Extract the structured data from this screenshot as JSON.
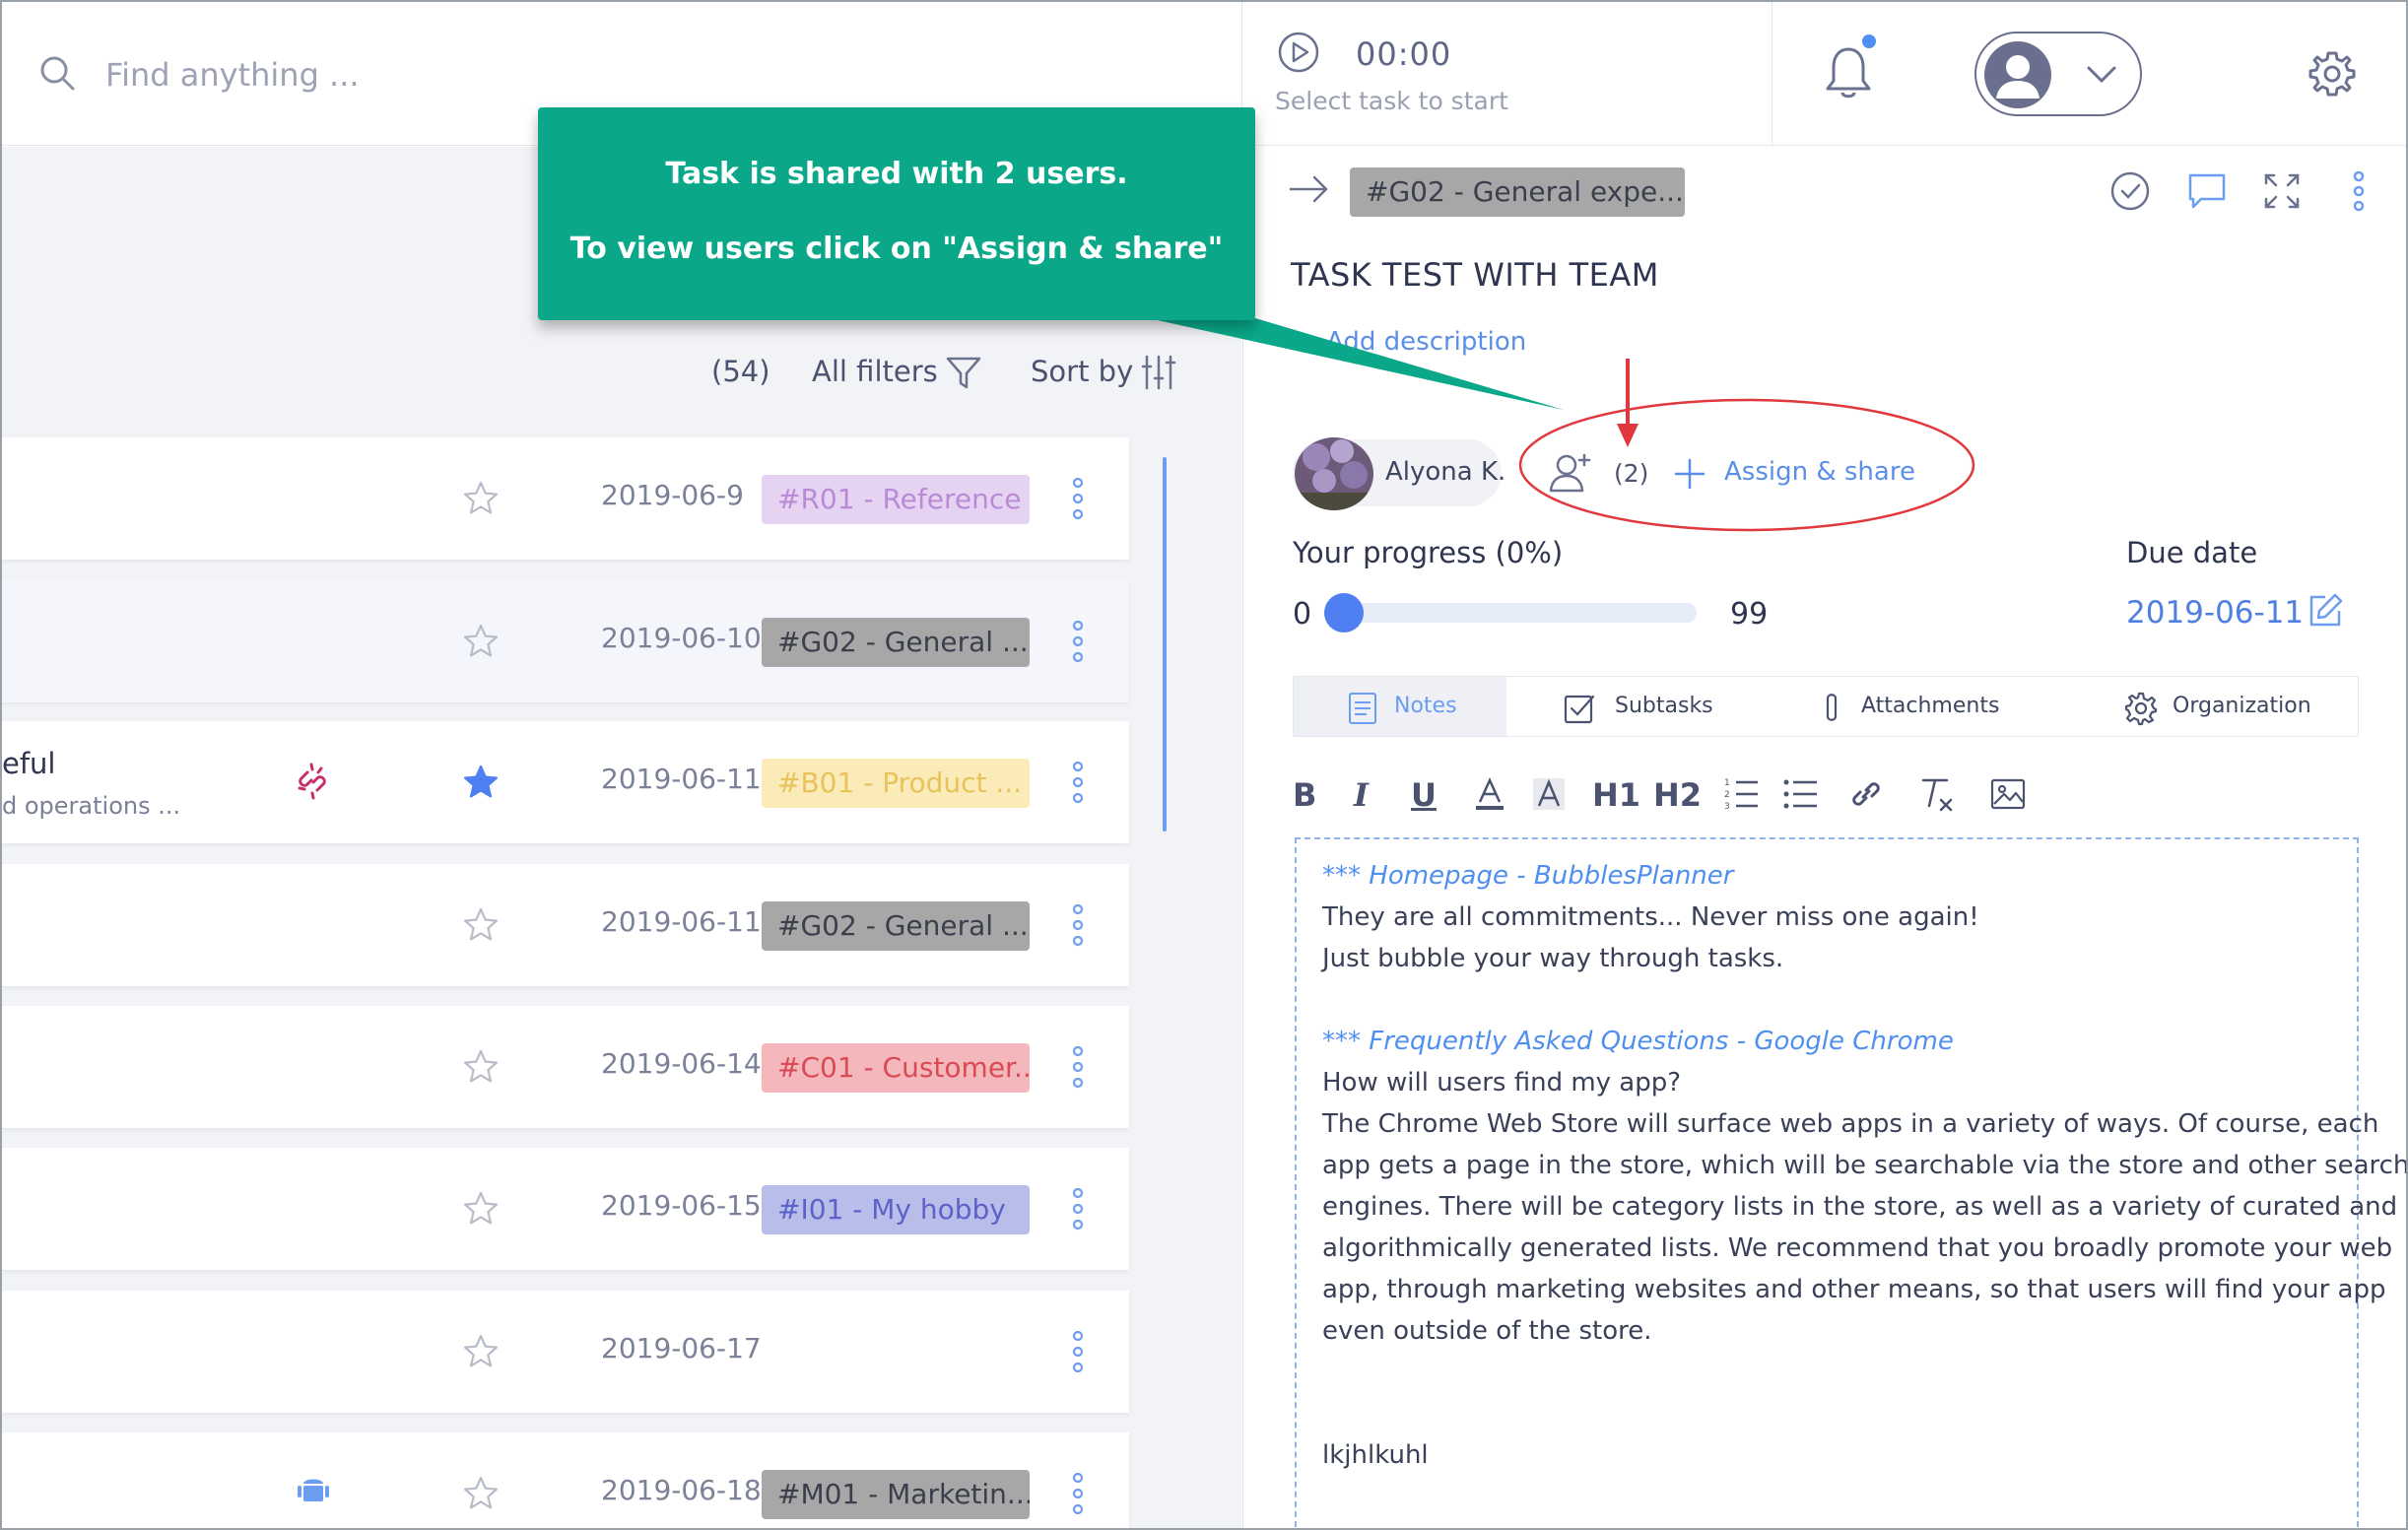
{
  "search": {
    "placeholder": "Find anything ..."
  },
  "timer": {
    "time": "00:00",
    "hint": "Select task to start"
  },
  "list_toolbar": {
    "count": "(54)",
    "filters_label": "All filters",
    "sort_label": "Sort by"
  },
  "rows": [
    {
      "title": "",
      "subtitle": "",
      "date": "2019-06-9",
      "tag": "#R01 - Reference",
      "tag_bg": "#e6d3f2",
      "tag_fg": "#b98ad6",
      "starred": false
    },
    {
      "title": "",
      "subtitle": "",
      "date": "2019-06-10",
      "tag": "#G02 - General ...",
      "tag_bg": "#a7a7a7",
      "tag_fg": "#3b3f4c",
      "starred": false
    },
    {
      "title": "eful",
      "subtitle": "d operations ...",
      "date": "2019-06-11",
      "tag": "#B01 - Product ...",
      "tag_bg": "#faebb8",
      "tag_fg": "#e8c25a",
      "starred": true
    },
    {
      "title": "",
      "subtitle": "",
      "date": "2019-06-11",
      "tag": "#G02 - General ...",
      "tag_bg": "#a7a7a7",
      "tag_fg": "#3b3f4c",
      "starred": false
    },
    {
      "title": "",
      "subtitle": "",
      "date": "2019-06-14",
      "tag": "#C01 - Customer...",
      "tag_bg": "#f3b7bc",
      "tag_fg": "#d94a55",
      "starred": false
    },
    {
      "title": "",
      "subtitle": "",
      "date": "2019-06-15",
      "tag": "#I01 - My hobby",
      "tag_bg": "#b9bde9",
      "tag_fg": "#5c63c8",
      "starred": false
    },
    {
      "title": "",
      "subtitle": "",
      "date": "2019-06-17",
      "tag": "",
      "tag_bg": "",
      "tag_fg": "",
      "starred": false
    },
    {
      "title": "",
      "subtitle": "",
      "date": "2019-06-18",
      "tag": "#M01 - Marketin...",
      "tag_bg": "#a7a7a7",
      "tag_fg": "#3b3f4c",
      "starred": false
    }
  ],
  "callout": {
    "line1": "Task is shared with 2 users.",
    "line2": "To view users click on \"Assign & share\""
  },
  "task": {
    "tag": "#G02 - General expe...",
    "title": "TASK TEST WITH TEAM",
    "add_description": "+ Add description",
    "assignee": "Alyona K.",
    "shared_count": "(2)",
    "assign_label": "Assign & share",
    "progress_label": "Your progress  (0%)",
    "progress_min": "0",
    "progress_max": "99",
    "progress_value": 0,
    "due_label": "Due date",
    "due_value": "2019-06-11"
  },
  "tabs": [
    {
      "label": "Notes",
      "icon": "notes-icon",
      "active": true
    },
    {
      "label": "Subtasks",
      "icon": "checkbox-icon",
      "active": false
    },
    {
      "label": "Attachments",
      "icon": "paperclip-icon",
      "active": false
    },
    {
      "label": "Organization",
      "icon": "gear-icon",
      "active": false
    }
  ],
  "toolbar_text": {
    "h1": "H1",
    "h2": "H2"
  },
  "notes": [
    {
      "text": "*** Homepage - BubblesPlanner",
      "link": true
    },
    {
      "text": "They are all commitments... Never miss one again!",
      "link": false
    },
    {
      "text": "Just bubble your way through tasks.",
      "link": false
    },
    {
      "text": "",
      "link": false
    },
    {
      "text": "*** Frequently Asked Questions - Google Chrome",
      "link": true
    },
    {
      "text": "How will users find my app?",
      "link": false
    },
    {
      "text": "The Chrome Web Store will surface web apps in a variety of ways. Of course, each",
      "link": false
    },
    {
      "text": "app gets a page in the store, which will be searchable via the store and other search",
      "link": false
    },
    {
      "text": "engines. There will be category lists in the store, as well as a variety of curated and",
      "link": false
    },
    {
      "text": "algorithmically generated lists. We recommend that you broadly promote your web",
      "link": false
    },
    {
      "text": "app, through marketing websites and other means, so that users will find your app",
      "link": false
    },
    {
      "text": "even outside of the store.",
      "link": false
    },
    {
      "text": "",
      "link": false
    },
    {
      "text": "",
      "link": false
    },
    {
      "text": "lkjhlkuhl",
      "link": false
    }
  ],
  "colors": {
    "accent": "#4f8ff0",
    "callout": "#0aa889",
    "highlight": "#e0383e"
  }
}
